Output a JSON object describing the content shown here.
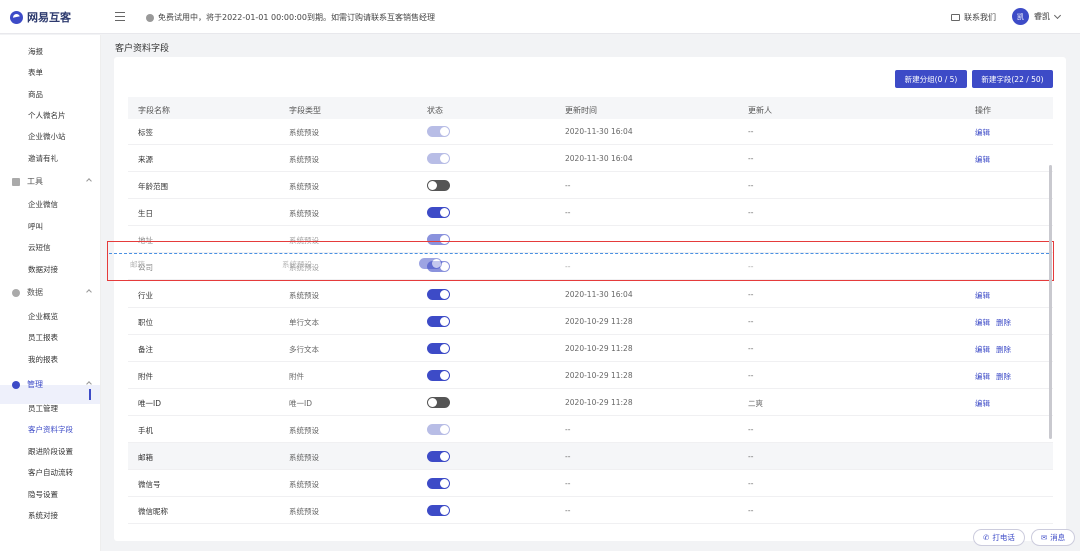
{
  "topbar": {
    "brand": "网易互客",
    "notice": "免费试用中，将于2022-01-01 00:00:00到期。如需订购请联系互客销售经理",
    "contact": "联系我们",
    "avatar_text": "凯",
    "username": "睿凯"
  },
  "sidebar": {
    "items_top": [
      "海报",
      "表单",
      "商品",
      "个人微名片",
      "企业微小站",
      "邀请有礼"
    ],
    "group_tools": "工具",
    "items_tools": [
      "企业微信",
      "呼叫",
      "云短信",
      "数据对接"
    ],
    "group_data": "数据",
    "items_data": [
      "企业概览",
      "员工报表",
      "我的报表"
    ],
    "group_manage": "管理",
    "items_manage": [
      "员工管理",
      "客户资料字段",
      "跟进阶段设置",
      "客户自动流转",
      "隐号设置",
      "系统对接"
    ]
  },
  "breadcrumb": "客户资料字段",
  "buttons": {
    "new_group": "新建分组(0 / 5)",
    "new_field": "新建字段(22 / 50)"
  },
  "table": {
    "headers": [
      "字段名称",
      "字段类型",
      "状态",
      "更新时间",
      "更新人",
      "操作"
    ],
    "rows": [
      {
        "name": "标签",
        "type": "系统预设",
        "status": "disabled",
        "time": "2020-11-30 16:04",
        "by": "--",
        "edit": "编辑",
        "del": ""
      },
      {
        "name": "来源",
        "type": "系统预设",
        "status": "disabled",
        "time": "2020-11-30 16:04",
        "by": "--",
        "edit": "编辑",
        "del": ""
      },
      {
        "name": "年龄范围",
        "type": "系统预设",
        "status": "off",
        "time": "--",
        "by": "--",
        "edit": "",
        "del": ""
      },
      {
        "name": "生日",
        "type": "系统预设",
        "status": "on",
        "time": "--",
        "by": "--",
        "edit": "",
        "del": ""
      },
      {
        "name": "地址",
        "type": "系统预设",
        "status": "on",
        "time": "",
        "by": "",
        "edit": "",
        "del": ""
      },
      {
        "name": "公司",
        "type": "系统预设",
        "status": "on",
        "time": "--",
        "by": "--",
        "edit": "",
        "del": ""
      },
      {
        "name": "行业",
        "type": "系统预设",
        "status": "on",
        "time": "2020-11-30 16:04",
        "by": "--",
        "edit": "编辑",
        "del": ""
      },
      {
        "name": "职位",
        "type": "单行文本",
        "status": "on",
        "time": "2020-10-29 11:28",
        "by": "--",
        "edit": "编辑",
        "del": "删除"
      },
      {
        "name": "备注",
        "type": "多行文本",
        "status": "on",
        "time": "2020-10-29 11:28",
        "by": "--",
        "edit": "编辑",
        "del": "删除"
      },
      {
        "name": "附件",
        "type": "附件",
        "status": "on",
        "time": "2020-10-29 11:28",
        "by": "--",
        "edit": "编辑",
        "del": "删除"
      },
      {
        "name": "唯一ID",
        "type": "唯一ID",
        "status": "off",
        "time": "2020-10-29 11:28",
        "by": "二爽",
        "edit": "编辑",
        "del": ""
      },
      {
        "name": "手机",
        "type": "系统预设",
        "status": "disabled",
        "time": "--",
        "by": "--",
        "edit": "",
        "del": ""
      },
      {
        "name": "邮箱",
        "type": "系统预设",
        "status": "on",
        "time": "--",
        "by": "--",
        "edit": "",
        "del": ""
      },
      {
        "name": "微信号",
        "type": "系统预设",
        "status": "on",
        "time": "--",
        "by": "--",
        "edit": "",
        "del": ""
      },
      {
        "name": "微信昵称",
        "type": "系统预设",
        "status": "on",
        "time": "--",
        "by": "--",
        "edit": "",
        "del": ""
      }
    ]
  },
  "drag_ghost": {
    "name": "邮箱",
    "type": "系统预设"
  },
  "float_buttons": {
    "call": "打电话",
    "message": "消息"
  },
  "colors": {
    "accent": "#3d4bc7",
    "highlight": "#e53b3b",
    "drop_line": "#4a90e2"
  }
}
